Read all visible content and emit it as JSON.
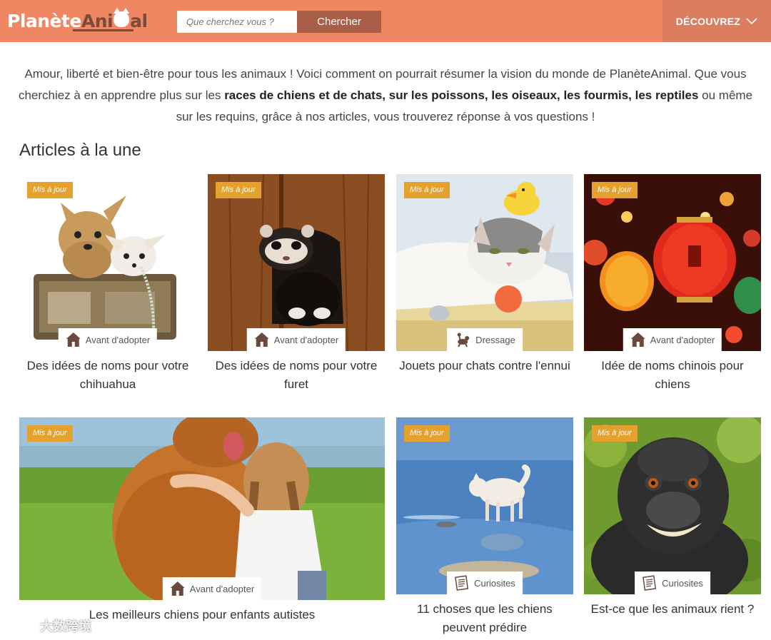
{
  "header": {
    "logo_text_a": "Planète",
    "logo_text_b": "Ani",
    "logo_text_c": "al",
    "search_placeholder": "Que cherchez vous ?",
    "search_button": "Chercher",
    "discover_label": "DÉCOUVREZ"
  },
  "intro": {
    "part1": "Amour, liberté et bien-être pour tous les animaux ! Voici comment on pourrait résumer la vision du monde de PlanèteAnimal. Que vous cherchiez à en apprendre plus sur les ",
    "bold": "races de chiens et de chats, sur les poissons, les oiseaux, les fourmis, les reptiles",
    "part2": " ou même sur les requins, grâce à nos articles, vous trouverez réponse à vos questions !"
  },
  "section_title": "Articles à la une",
  "articles": [
    {
      "badge": "Mis à jour",
      "category": "Avant d'adopter",
      "category_icon": "house-icon",
      "title": "Des idées de noms pour votre chihuahua"
    },
    {
      "badge": "Mis à jour",
      "category": "Avant d'adopter",
      "category_icon": "house-icon",
      "title": "Des idées de noms pour votre furet"
    },
    {
      "badge": "Mis à jour",
      "category": "Dressage",
      "category_icon": "dog-training-icon",
      "title": "Jouets pour chats contre l'ennui"
    },
    {
      "badge": "Mis à jour",
      "category": "Avant d'adopter",
      "category_icon": "house-icon",
      "title": "Idée de noms chinois pour chiens"
    },
    {
      "badge": "Mis à jour",
      "category": "Avant d'adopter",
      "category_icon": "house-icon",
      "title": "Les meilleurs chiens pour enfants autistes"
    },
    {
      "badge": "Mis à jour",
      "category": "Curiosites",
      "category_icon": "newspaper-icon",
      "title": "11 choses que les chiens peuvent prédire"
    },
    {
      "badge": "Mis à jour",
      "category": "Curiosites",
      "category_icon": "newspaper-icon",
      "title": "Est-ce que les animaux rient ?"
    }
  ],
  "watermark": "大数跨境",
  "colors": {
    "header_bg": "#ef8763",
    "search_button_bg": "#a85e49",
    "discover_bg": "#dd7d5f",
    "badge_bg": "#e5a12d"
  }
}
